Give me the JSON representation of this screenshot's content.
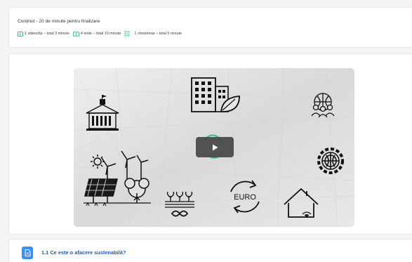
{
  "summary": {
    "title": "Conținut - 20 de minute pentru finalizare",
    "items": [
      {
        "icon": "video-clip-icon",
        "text": "1 videoclip – total 3 minute"
      },
      {
        "icon": "book-icon",
        "text": "4 texte – total 10 minute"
      },
      {
        "icon": "list-icon",
        "text": "1 chestionar – total 5 minute"
      }
    ]
  },
  "video": {
    "thumbnail_icons": [
      "government-building-icon",
      "green-office-building-icon",
      "community-globe-icon",
      "solar-wind-farm-icon",
      "gear-globe-icon",
      "sprout-infinity-icon",
      "euro-cycle-icon",
      "smart-home-icon"
    ],
    "thumbnail_text": "EURO",
    "play_button": "play-icon"
  },
  "lesson": {
    "title": "1.1 Ce este o afacere sustenabilă?"
  },
  "colors": {
    "accent_green": "#2fb673",
    "link_blue": "#1e5fb8",
    "icon_blue": "#3d8ef2"
  }
}
